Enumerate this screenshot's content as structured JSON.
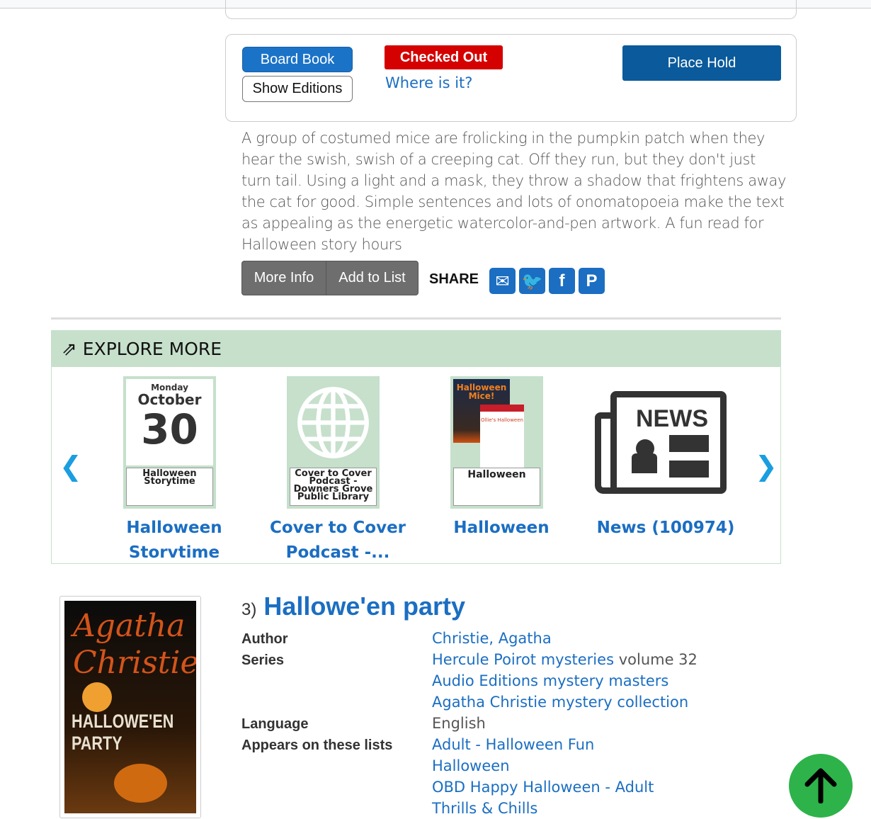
{
  "item": {
    "format_label": "Board Book",
    "show_editions_label": "Show Editions",
    "status": "Checked Out",
    "where_label": "Where is it?",
    "place_hold_label": "Place Hold",
    "description": "A group of costumed mice are frolicking in the pumpkin patch when they hear the swish, swish of a creeping cat. Off they run, but they don't just turn tail. Using a light and a mask, they throw a shadow that frightens away the cat for good. Simple sentences and lots of onomatopoeia make the text as appealing as the energetic watercolor-and-pen artwork. A fun read for Halloween story hours",
    "more_info_label": "More Info",
    "add_to_list_label": "Add to List",
    "share_label": "SHARE",
    "share_icons": [
      "email-icon",
      "twitter-icon",
      "facebook-icon",
      "pinterest-icon"
    ]
  },
  "explore": {
    "title": "EXPLORE MORE",
    "items": [
      {
        "tile_day": "Monday",
        "tile_month": "October",
        "tile_date": "30",
        "tile_label": "Halloween Storytime",
        "caption": "Halloween Storvtime"
      },
      {
        "tile_label": "Cover to Cover Podcast - Downers Grove Public Library",
        "caption": "Cover to Cover Podcast -..."
      },
      {
        "tile_cover_title": "Halloween Mice!",
        "tile_cover2_title": "Ollie's Halloween",
        "tile_label": "Halloween",
        "caption": "Halloween"
      },
      {
        "tile_text": "NEWS",
        "caption": "News (100974)"
      }
    ]
  },
  "result": {
    "number": "3)",
    "title": "Hallowe'en party",
    "cover_text": "Agatha Christie HALLOWE'EN PARTY",
    "author_label": "Author",
    "author": "Christie, Agatha",
    "series_label": "Series",
    "series": [
      "Hercule Poirot mysteries",
      "Audio Editions mystery masters",
      "Agatha Christie mystery collection"
    ],
    "series_volume": "volume 32",
    "language_label": "Language",
    "language": "English",
    "lists_label": "Appears on these lists",
    "lists": [
      "Adult - Halloween Fun",
      "Halloween",
      "OBD Happy Halloween - Adult",
      "Thrills & Chills"
    ]
  },
  "colors": {
    "link": "#1b6ec2",
    "status": "#d50000",
    "hold": "#0a5a9c",
    "explore_bg": "#c6e0cb",
    "top_button": "#2db34a"
  }
}
